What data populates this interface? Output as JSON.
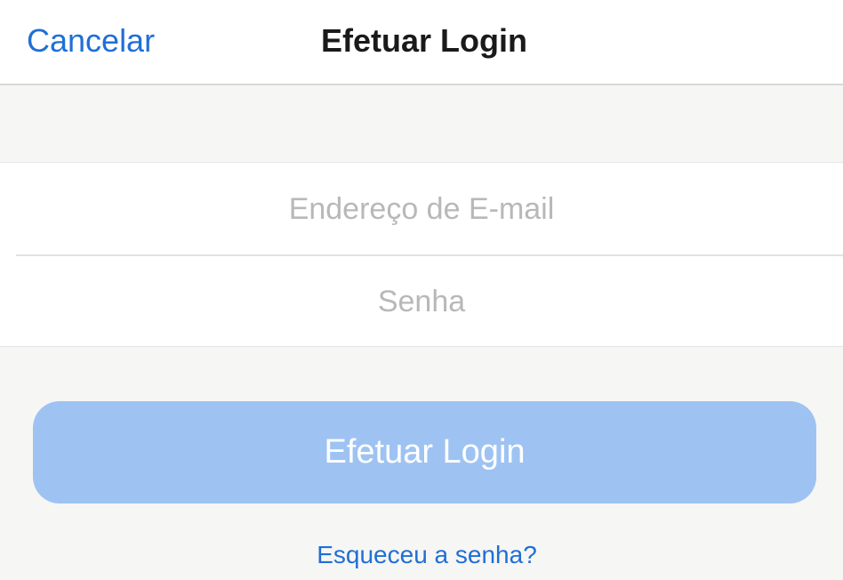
{
  "nav": {
    "cancel_label": "Cancelar",
    "title": "Efetuar Login"
  },
  "form": {
    "email": {
      "placeholder": "Endereço de E-mail",
      "value": ""
    },
    "password": {
      "placeholder": "Senha",
      "value": ""
    }
  },
  "login_button": {
    "label": "Efetuar Login",
    "state": "disabled"
  },
  "forgot_password": {
    "label": "Esqueceu a senha?"
  },
  "colors": {
    "accent": "#1f6fd6",
    "button_disabled": "#9ec3f3",
    "background": "#f6f6f4",
    "surface": "#ffffff"
  }
}
